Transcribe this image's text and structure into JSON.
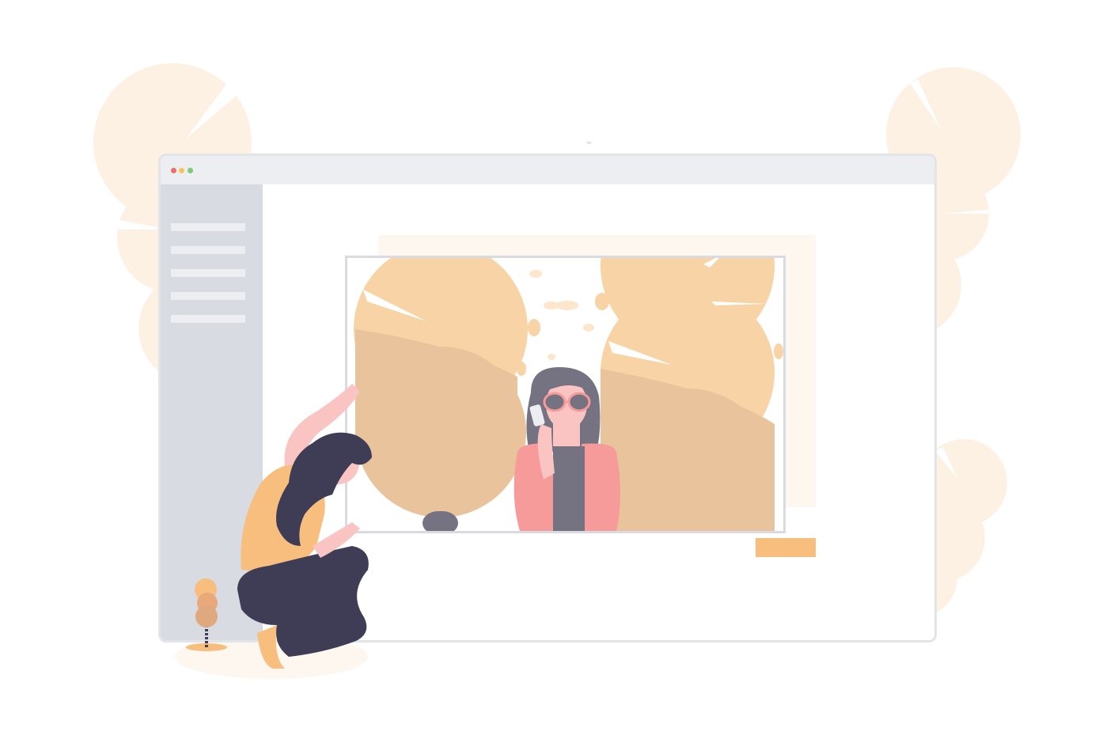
{
  "colors": {
    "background": "#ffffff",
    "window_border": "#e3e4e8",
    "titlebar": "#eceef2",
    "sidebar": "#d8dbe1",
    "sidebar_line": "#eceef2",
    "accent_orange": "#f8be7e",
    "tree_light": "#fdf1e3",
    "tree_peach": "#f8d3a6",
    "tree_shade": "#e9c39c",
    "dark_hair": "#3f3d56",
    "skin": "#f9c4c2",
    "jacket_pink": "#f79a9a",
    "dark_gray": "#757281"
  },
  "window": {
    "traffic_lights": [
      {
        "name": "close",
        "color": "#f16c6c"
      },
      {
        "name": "minimize",
        "color": "#f5c55a"
      },
      {
        "name": "maximize",
        "color": "#7fc77a"
      }
    ]
  },
  "sidebar": {
    "items": [
      {
        "label": ""
      },
      {
        "label": ""
      },
      {
        "label": ""
      },
      {
        "label": ""
      },
      {
        "label": ""
      }
    ]
  },
  "photo": {
    "subject": "woman-with-sunglasses-taking-selfie",
    "background_plants": "peach-trees"
  },
  "cta_button": {
    "label": ""
  },
  "illustration": {
    "foreground_person": "woman-crouching-holding-photo",
    "small_plant": "peach-plant"
  }
}
